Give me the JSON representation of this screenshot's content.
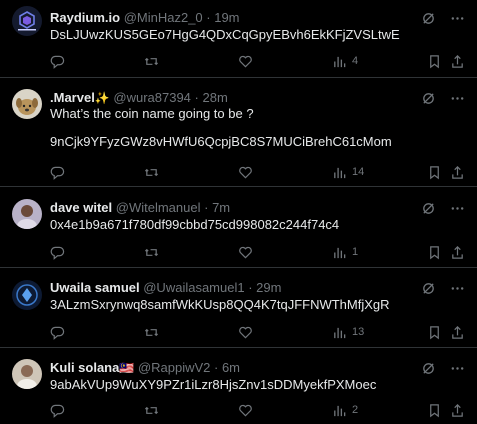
{
  "tweets": [
    {
      "name": "Raydium.io",
      "handle": "@MinHaz2_0",
      "time": "· 19m",
      "text": "DsLJUwzKUS5GEo7HgG4QDxCqGpyEBvh6EkKFjZVSLtwE",
      "views": "4",
      "avatar": "raydium-logo"
    },
    {
      "name": ".Marvel",
      "name_emoji": "✨",
      "handle": "@wura87394",
      "time": "· 28m",
      "text": "What’s the coin name going to be ?\n\n9nCjk9YFyzGWz8vHWfU6QcpjBC8S7MUCiBrehC61cMom",
      "views": "14",
      "avatar": "dog-photo"
    },
    {
      "name": "dave witel",
      "handle": "@Witelmanuel",
      "time": "· 7m",
      "text": "0x4e1b9a671f780df99cbbd75cd998082c244f74c4",
      "views": "1",
      "avatar": "person-photo"
    },
    {
      "name": "Uwaila samuel",
      "handle": "@Uwailasamuel1",
      "time": "· 29m",
      "text": "3ALzmSxrynwq8samfWkKUsp8QQ4K7tqJFFNWThMfjXgR",
      "views": "13",
      "avatar": "crypto-logo"
    },
    {
      "name": "Kuli solana",
      "name_emoji": "🇲🇾",
      "handle": "@RappiwV2",
      "time": "· 6m",
      "text": "9abAkVUp9WuXY9PZr1iLzr8HjsZnv1sDDMyekfPXMoec",
      "views": "2",
      "avatar": "person-photo-2"
    }
  ],
  "icons": {
    "grok": "grok-icon",
    "more": "more-icon",
    "reply": "reply-icon",
    "retweet": "retweet-icon",
    "like": "like-icon",
    "views": "views-icon",
    "bookmark": "bookmark-icon",
    "share": "share-icon"
  },
  "colors": {
    "background": "#000000",
    "text": "#e7e9ea",
    "secondary": "#71767b",
    "divider": "#2f3336"
  }
}
